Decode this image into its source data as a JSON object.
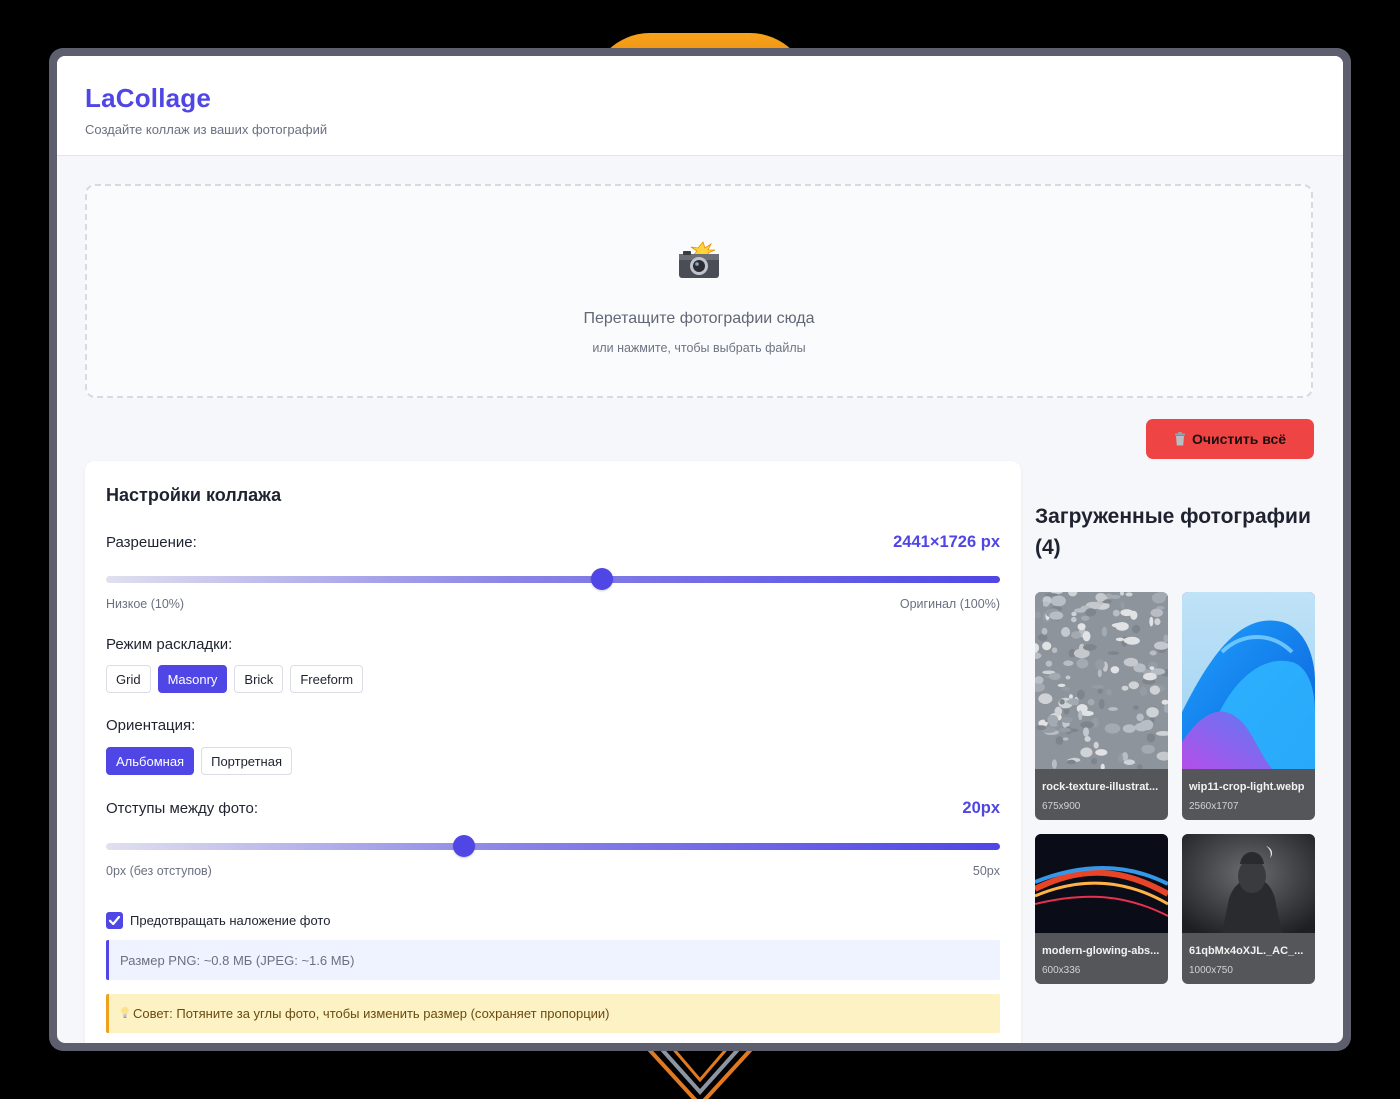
{
  "header": {
    "title": "LaCollage",
    "subtitle": "Создайте коллаж из ваших фотографий"
  },
  "dropzone": {
    "icon": "camera-flash-icon",
    "title": "Перетащите фотографии сюда",
    "hint": "или нажмите, чтобы выбрать файлы"
  },
  "actions": {
    "clear_all_label": "Очистить всё",
    "clear_all_icon": "trash-icon"
  },
  "settings": {
    "title": "Настройки коллажа",
    "resolution": {
      "label": "Разрешение:",
      "value": "2441×1726 px",
      "slider_fraction": 0.555,
      "min_label": "Низкое (10%)",
      "max_label": "Оригинал (100%)"
    },
    "layout": {
      "label": "Режим раскладки:",
      "options": [
        "Grid",
        "Masonry",
        "Brick",
        "Freeform"
      ],
      "selected": "Masonry"
    },
    "orientation": {
      "label": "Ориентация:",
      "options": [
        "Альбомная",
        "Портретная"
      ],
      "selected": "Альбомная"
    },
    "spacing": {
      "label": "Отступы между фото:",
      "value": "20px",
      "slider_fraction": 0.4,
      "min_label": "0px (без отступов)",
      "max_label": "50px"
    },
    "prevent_overlap": {
      "label": "Предотвращать наложение фото",
      "checked": true
    },
    "size_info": "Размер PNG: ~0.8 МБ (JPEG: ~1.6 МБ)",
    "tip": "Совет: Потяните за углы фото, чтобы изменить размер (сохраняет пропорции)",
    "tip_icon": "lightbulb-icon"
  },
  "photos": {
    "title": "Загруженные фотографии (4)",
    "items": [
      {
        "name": "rock-texture-illustrat...",
        "dims": "675x900"
      },
      {
        "name": "wip11-crop-light.webp",
        "dims": "2560x1707"
      },
      {
        "name": "modern-glowing-abs...",
        "dims": "600x336"
      },
      {
        "name": "61qbMx4oXJL._AC_...",
        "dims": "1000x750"
      }
    ]
  },
  "colors": {
    "accent": "#4f46e5",
    "danger": "#ef4444",
    "tip_border": "#f0a020"
  }
}
